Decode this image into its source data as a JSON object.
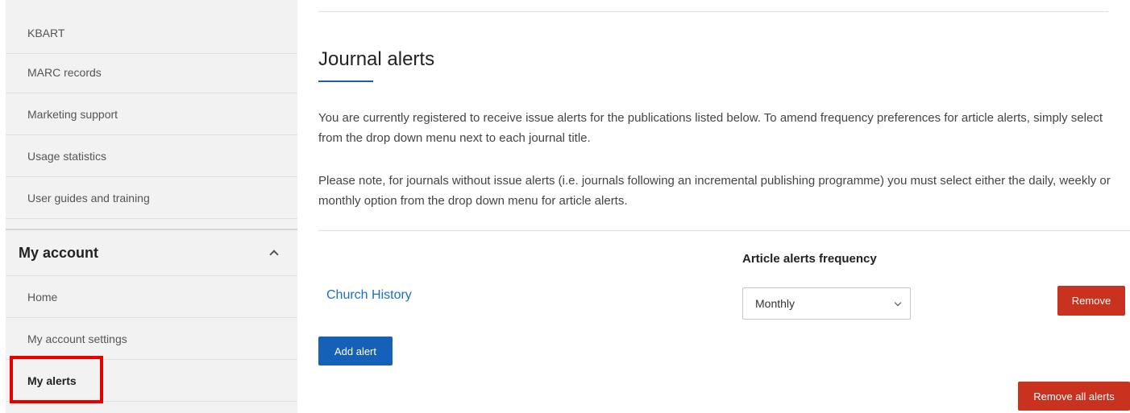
{
  "sidebar": {
    "items": [
      {
        "label": "KBART"
      },
      {
        "label": "MARC records"
      },
      {
        "label": "Marketing support"
      },
      {
        "label": "Usage statistics"
      },
      {
        "label": "User guides and training"
      }
    ],
    "section": {
      "title": "My account",
      "items": [
        {
          "label": "Home"
        },
        {
          "label": "My account settings"
        },
        {
          "label": "My alerts"
        }
      ]
    }
  },
  "main": {
    "title": "Journal alerts",
    "paragraph1": "You are currently registered to receive issue alerts for the publications listed below. To amend frequency preferences for article alerts, simply select from the drop down menu next to each journal title.",
    "paragraph2": "Please note, for journals without issue alerts (i.e. journals following an incremental publishing programme) you must select either the daily, weekly or monthly option from the drop down menu for article alerts.",
    "frequency_header": "Article alerts frequency",
    "alerts": [
      {
        "journal": "Church History",
        "frequency": "Monthly",
        "remove_label": "Remove"
      }
    ],
    "add_alert_label": "Add alert",
    "remove_all_label": "Remove all alerts"
  },
  "colors": {
    "accent": "#1560b8",
    "link": "#1a6fc4",
    "danger": "#c8321f",
    "highlight": "#e60000",
    "sidebar_bg": "#f2f2f2"
  }
}
